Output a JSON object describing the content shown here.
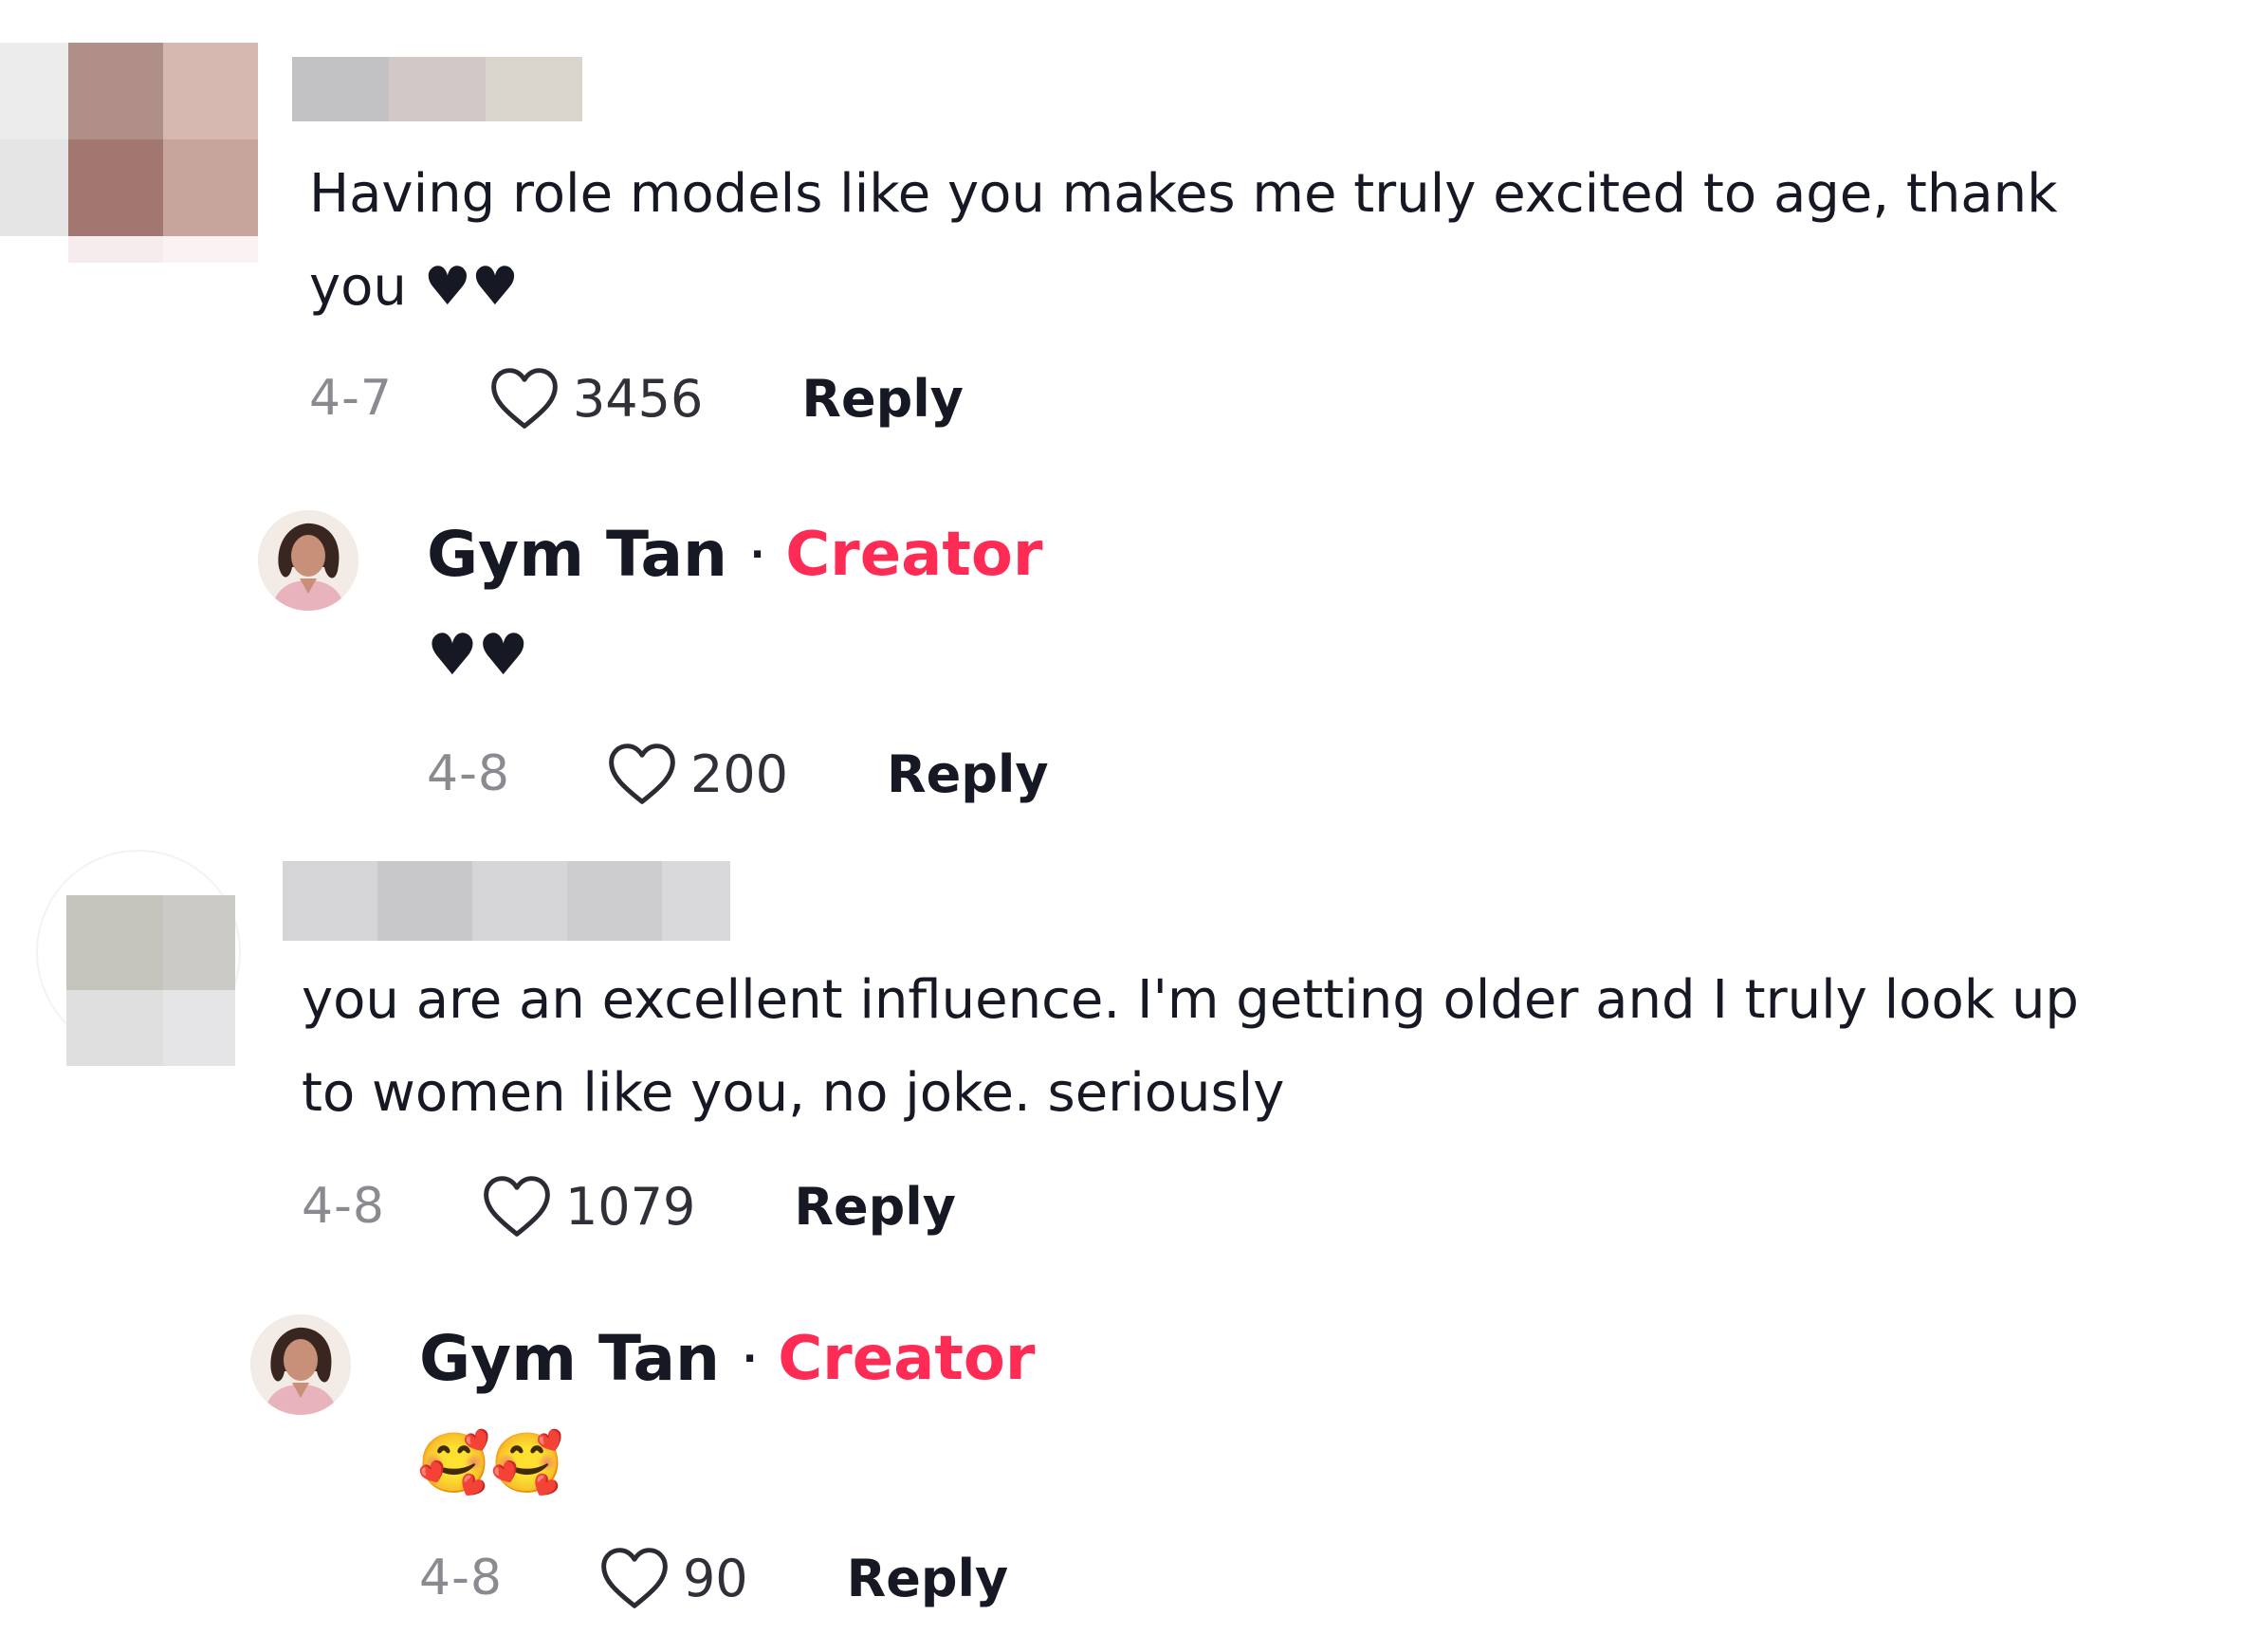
{
  "comments": [
    {
      "text_line1": "Having role models like you makes me truly excited to age, thank",
      "text_line2": "you ♥♥",
      "date": "4-7",
      "likes": "3456",
      "reply_label": "Reply",
      "reply": {
        "author": "Gym Tan",
        "separator": "·",
        "badge": "Creator",
        "text": "♥♥",
        "date": "4-8",
        "likes": "200",
        "reply_label": "Reply"
      }
    },
    {
      "text_line1": "you are an excellent influence. I'm getting older and I truly look up",
      "text_line2": "to women like you, no joke. seriously",
      "date": "4-8",
      "likes": "1079",
      "reply_label": "Reply",
      "reply": {
        "author": "Gym Tan",
        "separator": "·",
        "badge": "Creator",
        "text": "🥰🥰",
        "date": "4-8",
        "likes": "90",
        "reply_label": "Reply"
      }
    }
  ],
  "icons": {
    "like": "heart-outline-icon",
    "avatar_blurred": "pixelated-avatar",
    "creator_avatar": "creator-avatar"
  },
  "colors": {
    "creator_badge": "#fe2c55",
    "meta_text": "#8a8b91",
    "primary_text": "#161823"
  }
}
